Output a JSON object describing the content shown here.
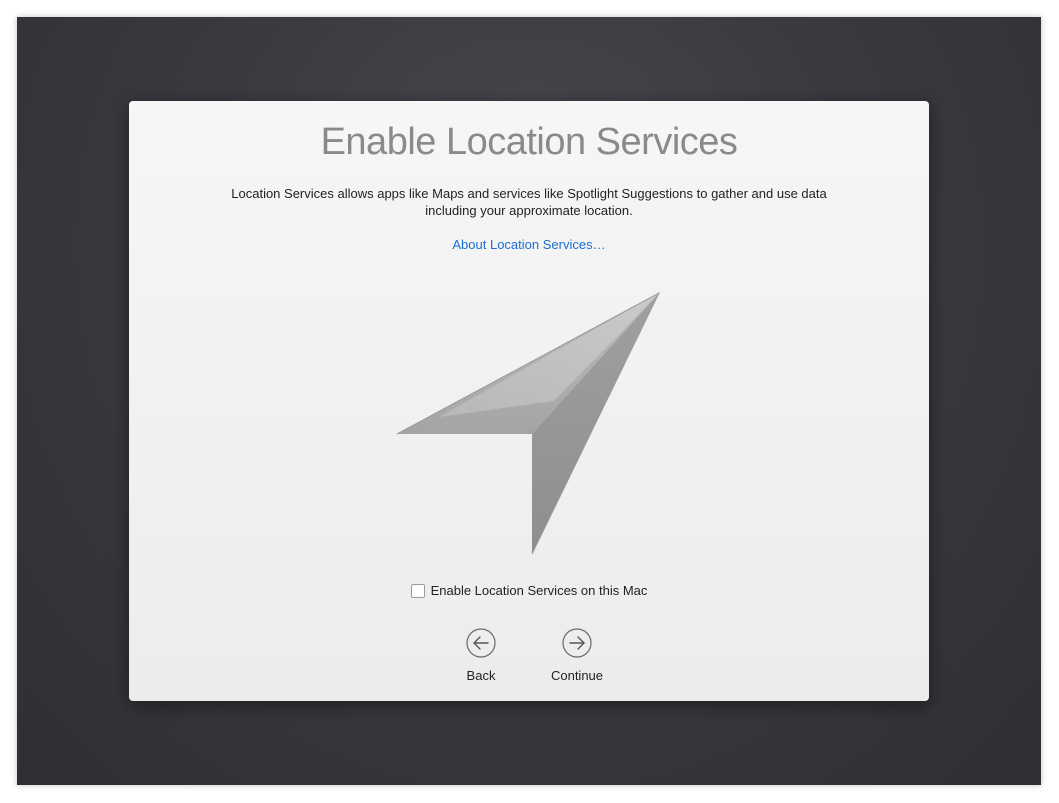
{
  "dialog": {
    "title": "Enable Location Services",
    "description": "Location Services allows apps like Maps and services like Spotlight Suggestions to gather and use data including your approximate location.",
    "about_link": "About Location Services…",
    "checkbox_label": "Enable Location Services on this Mac",
    "checkbox_checked": false,
    "graphic_icon": "location-arrow-icon"
  },
  "navigation": {
    "back_label": "Back",
    "back_icon": "arrow-left-circle-icon",
    "continue_label": "Continue",
    "continue_icon": "arrow-right-circle-icon"
  },
  "colors": {
    "link": "#1a6fd0",
    "title": "#8a8a8a",
    "background": "#3a3b40"
  }
}
